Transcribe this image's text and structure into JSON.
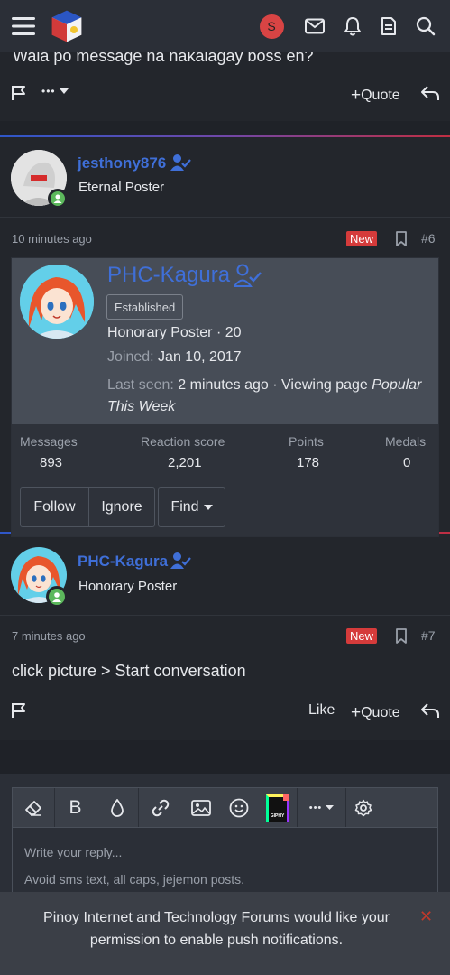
{
  "topbar": {
    "menu_icon": "hamburger-icon",
    "logo_icon": "phc-logo-icon",
    "user_avatar_letter": "S",
    "icons": [
      "envelope-icon",
      "bell-icon",
      "document-icon",
      "search-icon"
    ]
  },
  "prev_post": {
    "cut_text": "Wala po message na nakalagay boss en?",
    "actions": {
      "more": "•••",
      "quote": "Quote"
    }
  },
  "post6": {
    "username": "jesthony876",
    "user_title": "Eternal Poster",
    "time": "10 minutes ago",
    "badge": "New",
    "number": "#6"
  },
  "popup": {
    "username": "PHC-Kagura",
    "banner": "Established",
    "title_line": "Honorary Poster · 20",
    "joined_label": "Joined:",
    "joined_value": "Jan 10, 2017",
    "lastseen_label": "Last seen:",
    "lastseen_value": "2 minutes ago · Viewing page",
    "lastseen_page_1": "Popular",
    "lastseen_page_2": "This Week",
    "stats": [
      {
        "label": "Messages",
        "value": "893"
      },
      {
        "label": "Reaction score",
        "value": "2,201"
      },
      {
        "label": "Points",
        "value": "178"
      },
      {
        "label": "Medals",
        "value": "0"
      }
    ],
    "buttons": {
      "follow": "Follow",
      "ignore": "Ignore",
      "find": "Find"
    }
  },
  "post7": {
    "username": "PHC-Kagura",
    "user_title": "Honorary Poster",
    "time": "7 minutes ago",
    "badge": "New",
    "number": "#7",
    "body": "click picture > Start conversation",
    "actions": {
      "like": "Like",
      "quote": "Quote"
    }
  },
  "editor": {
    "toolbar_icons": [
      "eraser-icon",
      "bold-icon",
      "color-drop-icon",
      "link-icon",
      "image-icon",
      "smiley-icon",
      "giphy-icon",
      "more-icon",
      "gear-icon"
    ],
    "bold_label": "B",
    "giphy_label": "GIPHY",
    "placeholder_line1": "Write your reply...",
    "placeholder_line2": "Avoid sms text, all caps, jejemon posts."
  },
  "notification": {
    "message": "Pinoy Internet and Technology Forums would like your permission to enable push notifications.",
    "close": "✕"
  },
  "colors": {
    "accent_blue": "#3f6fd8",
    "new_red": "#d53b3b",
    "online_green": "#5cb85c"
  }
}
